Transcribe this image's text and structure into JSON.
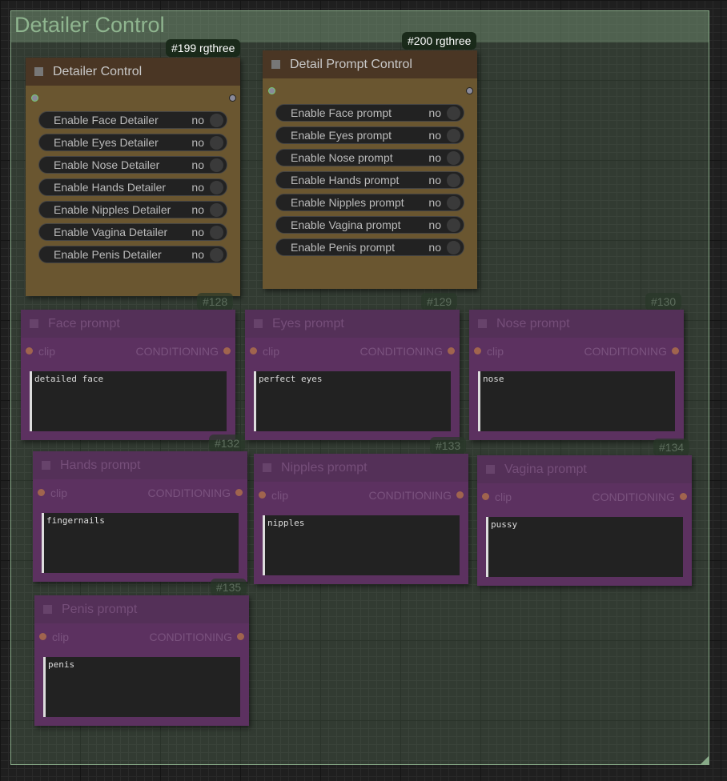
{
  "group": {
    "title": "Detailer Control"
  },
  "control_nodes": [
    {
      "badge": "#199 rgthree",
      "title": "Detailer Control",
      "toggles": [
        {
          "label": "Enable Face Detailer",
          "value": "no"
        },
        {
          "label": "Enable Eyes Detailer",
          "value": "no"
        },
        {
          "label": "Enable Nose Detailer",
          "value": "no"
        },
        {
          "label": "Enable Hands Detailer",
          "value": "no"
        },
        {
          "label": "Enable Nipples Detailer",
          "value": "no"
        },
        {
          "label": "Enable Vagina Detailer",
          "value": "no"
        },
        {
          "label": "Enable Penis Detailer",
          "value": "no"
        }
      ]
    },
    {
      "badge": "#200 rgthree",
      "title": "Detail Prompt Control",
      "toggles": [
        {
          "label": "Enable Face prompt",
          "value": "no"
        },
        {
          "label": "Enable Eyes prompt",
          "value": "no"
        },
        {
          "label": "Enable Nose prompt",
          "value": "no"
        },
        {
          "label": "Enable Hands prompt",
          "value": "no"
        },
        {
          "label": "Enable Nipples prompt",
          "value": "no"
        },
        {
          "label": "Enable Vagina prompt",
          "value": "no"
        },
        {
          "label": "Enable Penis prompt",
          "value": "no"
        }
      ]
    }
  ],
  "prompt_nodes": [
    {
      "badge": "#128",
      "title": "Face prompt",
      "input": "clip",
      "output": "CONDITIONING",
      "text": "detailed face"
    },
    {
      "badge": "#129",
      "title": "Eyes prompt",
      "input": "clip",
      "output": "CONDITIONING",
      "text": "perfect eyes"
    },
    {
      "badge": "#130",
      "title": "Nose prompt",
      "input": "clip",
      "output": "CONDITIONING",
      "text": "nose"
    },
    {
      "badge": "#132",
      "title": "Hands prompt",
      "input": "clip",
      "output": "CONDITIONING",
      "text": "fingernails"
    },
    {
      "badge": "#133",
      "title": "Nipples prompt",
      "input": "clip",
      "output": "CONDITIONING",
      "text": "nipples"
    },
    {
      "badge": "#134",
      "title": "Vagina prompt",
      "input": "clip",
      "output": "CONDITIONING",
      "text": "pussy"
    },
    {
      "badge": "#135",
      "title": "Penis prompt",
      "input": "clip",
      "output": "CONDITIONING",
      "text": "penis"
    }
  ]
}
